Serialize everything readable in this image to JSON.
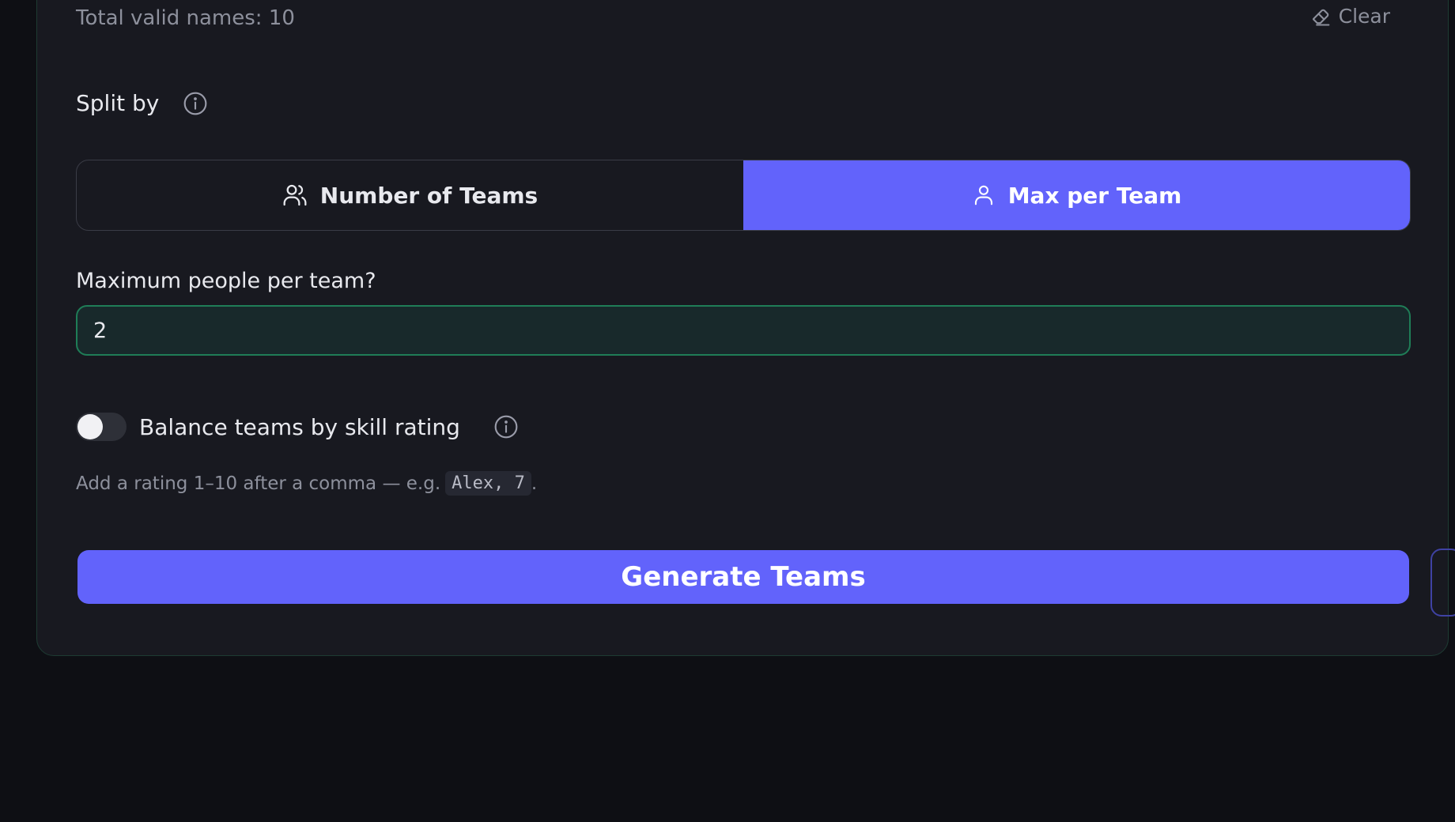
{
  "summary": {
    "total_label": "Total valid names: 10",
    "clear_label": "Clear"
  },
  "split": {
    "label": "Split by",
    "options": [
      {
        "label": "Number of Teams",
        "icon": "users-icon",
        "selected": false
      },
      {
        "label": "Max per Team",
        "icon": "user-icon",
        "selected": true
      }
    ]
  },
  "max_per_team": {
    "label": "Maximum people per team?",
    "value": "2"
  },
  "balance": {
    "label": "Balance teams by skill rating",
    "enabled": false,
    "hint_prefix": "Add a rating 1–10 after a comma — e.g.",
    "hint_example": "Alex, 7",
    "hint_suffix": "."
  },
  "generate": {
    "label": "Generate Teams"
  },
  "colors": {
    "accent": "#6263fb",
    "input_border": "#1f7d57",
    "background": "#0e0f14",
    "card": "#181920"
  }
}
